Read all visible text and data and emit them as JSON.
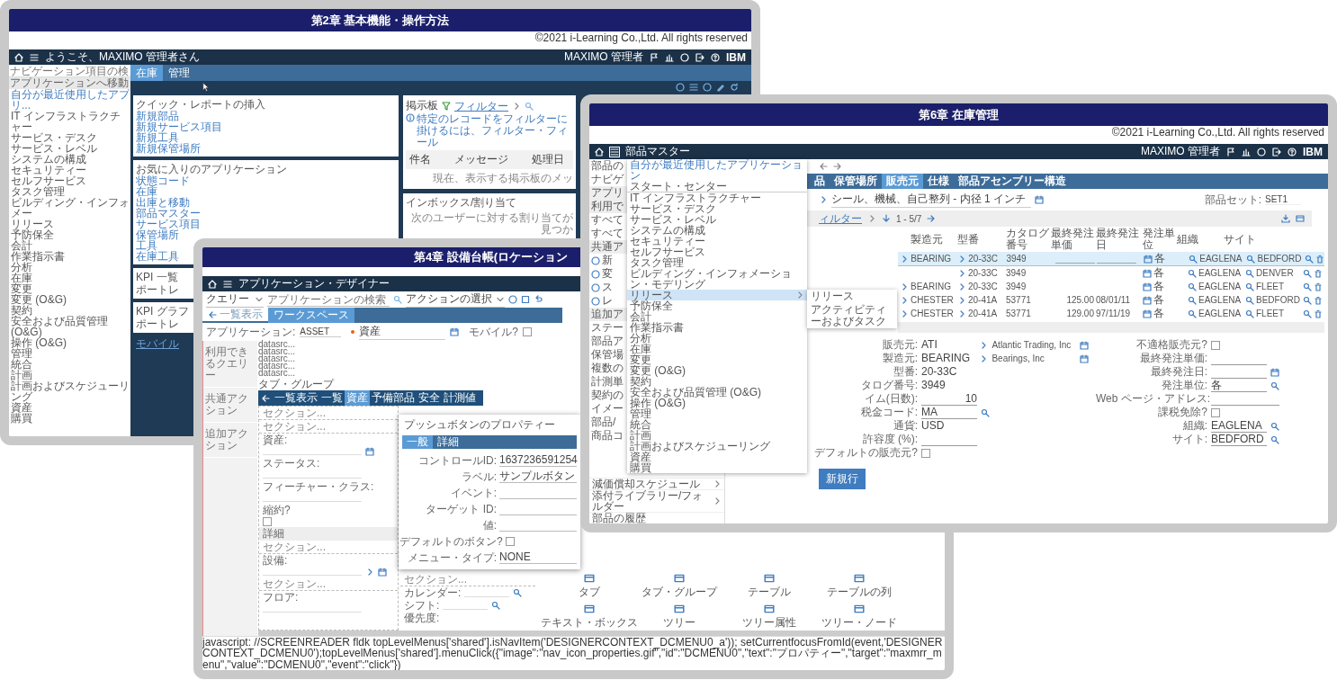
{
  "slide_basic": {
    "title": "第2章 基本機能・操作方法",
    "copyright": "©2021 i-Learning Co.,Ltd. All rights reserved",
    "navbar": {
      "title": "ようこそ、MAXIMO 管理者さん",
      "user": "MAXIMO 管理者",
      "brand": "IBM"
    },
    "sidebar": {
      "search_placeholder": "ナビゲーション項目の検",
      "header": "アプリケーションへ移動",
      "items": [
        {
          "label": "自分が最近使用したアプリ...",
          "kind": "link"
        },
        {
          "label": "IT インフラストラクチャー",
          "kind": "module"
        },
        {
          "label": "サービス・デスク",
          "kind": "module"
        },
        {
          "label": "サービス・レベル",
          "kind": "module"
        },
        {
          "label": "システムの構成",
          "kind": "module"
        },
        {
          "label": "セキュリティー",
          "kind": "module"
        },
        {
          "label": "セルフサービス",
          "kind": "module"
        },
        {
          "label": "タスク管理",
          "kind": "module"
        },
        {
          "label": "ビルディング・インフォメー",
          "kind": "module"
        },
        {
          "label": "リリース",
          "kind": "module"
        },
        {
          "label": "予防保全",
          "kind": "module"
        },
        {
          "label": "会計",
          "kind": "module"
        },
        {
          "label": "作業指示書",
          "kind": "module"
        },
        {
          "label": "分析",
          "kind": "module"
        },
        {
          "label": "在庫",
          "kind": "module"
        },
        {
          "label": "変更",
          "kind": "module"
        },
        {
          "label": "変更 (O&G)",
          "kind": "module"
        },
        {
          "label": "契約",
          "kind": "module"
        },
        {
          "label": "安全および品質管理 (O&G)",
          "kind": "module"
        },
        {
          "label": "操作 (O&G)",
          "kind": "module"
        },
        {
          "label": "管理",
          "kind": "module"
        },
        {
          "label": "統合",
          "kind": "module"
        },
        {
          "label": "計画",
          "kind": "module"
        },
        {
          "label": "計画およびスケジューリング",
          "kind": "module"
        },
        {
          "label": "資産",
          "kind": "module"
        },
        {
          "label": "購買",
          "kind": "module"
        }
      ]
    },
    "tabs": [
      {
        "label": "在庫",
        "selected": true
      },
      {
        "label": "管理",
        "selected": false
      }
    ],
    "quick_report": {
      "title": "クイック・レポートの挿入",
      "links": [
        "新規部品",
        "新規サービス項目",
        "新規工具",
        "新規保管場所"
      ]
    },
    "favorites": {
      "title": "お気に入りのアプリケーション",
      "links": [
        "状態コード",
        "在庫",
        "出庫と移動",
        "部品マスター",
        "サービス項目",
        "保管場所",
        "工具",
        "在庫工具"
      ]
    },
    "kpi_portlets": [
      {
        "title": "KPI 一覧",
        "message": "ポートレ"
      },
      {
        "title": "KPI グラフ",
        "message": "ポートレ"
      }
    ],
    "mobile_link": "モバイル",
    "bulletin": {
      "title": "掲示板",
      "filter": "フィルター",
      "info": "特定のレコードをフィルターに掛けるには、フィルター・フィール",
      "columns": [
        "件名",
        "メッセージ",
        "処理日"
      ],
      "empty": "現在、表示する掲示板のメッ"
    },
    "inbox": {
      "title": "インボックス/割り当て",
      "empty": "次のユーザーに対する割り当てが見つか"
    }
  },
  "slide_designer": {
    "title": "第4章 設備台帳(ロケーション",
    "navbar": {
      "title": "アプリケーション・デザイナー"
    },
    "toolbar": {
      "query": "クエリー",
      "search_placeholder": "アプリケーションの検索",
      "action": "アクションの選択"
    },
    "tabs": [
      {
        "label": "一覧表示",
        "selected": false
      },
      {
        "label": "ワークスペース",
        "selected": true
      }
    ],
    "app_label": "アプリケーション:",
    "app_value": "ASSET",
    "desc_value": "資産",
    "mobile_label": "モバイル?",
    "mobile_checked": false,
    "left_panel": [
      "利用できるクエリー",
      "共通アクション",
      "追加アクション"
    ],
    "datasources": [
      "datasrc...",
      "datasrc...",
      "datasrc...",
      "datasrc...",
      "datasrc..."
    ],
    "tab_group": "タブ・グループ",
    "inner_tabs": [
      {
        "label": "一覧表示",
        "selected": false
      },
      {
        "label": "一覧",
        "selected": false
      },
      {
        "label": "資産",
        "selected": true
      },
      {
        "label": "予備部品",
        "selected": false
      },
      {
        "label": "安全",
        "selected": false
      },
      {
        "label": "計測値",
        "selected": false
      }
    ],
    "canvas_left": [
      {
        "kind": "section",
        "label": "セクション..."
      },
      {
        "kind": "section",
        "label": "セクション..."
      },
      {
        "kind": "date_field",
        "label": "資産:"
      },
      {
        "kind": "field",
        "label": "ステータス:"
      },
      {
        "kind": "field",
        "label": "フィーチャー・クラス:"
      },
      {
        "kind": "checkbox",
        "label": "縮約?",
        "checked": false
      },
      {
        "kind": "band",
        "label": "詳細"
      },
      {
        "kind": "section",
        "label": "セクション..."
      },
      {
        "kind": "link_field",
        "label": "設備:"
      },
      {
        "kind": "section",
        "label": "セクション..."
      },
      {
        "kind": "field",
        "label": "フロア:"
      }
    ],
    "canvas_right": [
      {
        "kind": "section",
        "label": "セクション..."
      },
      {
        "kind": "lookup_field",
        "label": "カレンダー:"
      },
      {
        "kind": "lookup_field",
        "label": "シフト:"
      },
      {
        "kind": "field",
        "label": "優先度:"
      }
    ],
    "palette": [
      "タブ",
      "タブ・グループ",
      "テーブル",
      "テーブルの列",
      "テキスト・ボックス",
      "ツリー",
      "ツリー属性",
      "ツリー・ノード"
    ],
    "dialog": {
      "title": "プッシュボタンのプロパティー",
      "tabs": [
        {
          "label": "一般",
          "selected": true
        },
        {
          "label": "詳細",
          "selected": false
        }
      ],
      "fields": [
        {
          "label": "コントロールID:",
          "value": "1637236591254",
          "kind": "text"
        },
        {
          "label": "ラベル:",
          "value": "サンプルボタン",
          "kind": "text"
        },
        {
          "label": "イベント:",
          "kind": "text"
        },
        {
          "label": "ターゲット ID:",
          "kind": "text"
        },
        {
          "label": "値:",
          "kind": "text"
        },
        {
          "label": "デフォルトのボタン?",
          "kind": "checkbox",
          "checked": false
        },
        {
          "label": "メニュー・タイプ:",
          "value": "NONE",
          "kind": "text"
        }
      ]
    },
    "status": "javascript: //SCREENREADER fldk topLevelMenus['shared'].isNavItem('DESIGNERCONTEXT_DCMENU0_a')); setCurrentfocusFromId(event,'DESIGNERCONTEXT_DCMENU0');topLevelMenus['shared'].menuClick({\"image\":\"nav_icon_properties.gif\",\"id\":\"DCMENU0\",\"text\":\"プロパティー\",\"target\":\"maxmrr_menu\",\"value\":\"DCMENU0\",\"event\":\"click\"})"
  },
  "slide_inventory": {
    "title": "第6章 在庫管理",
    "copyright": "©2021 i-Learning Co.,Ltd. All rights reserved",
    "navbar": {
      "title": "部品マスター",
      "user": "MAXIMO 管理者",
      "brand": "IBM"
    },
    "sidebar_top": [
      {
        "label": "部品の",
        "kind": "text"
      },
      {
        "label": "ナビゲ",
        "kind": "text"
      },
      {
        "label": "アプリ",
        "kind": "header"
      },
      {
        "label": "利用で",
        "kind": "header"
      },
      {
        "label": "すべて",
        "kind": "text"
      },
      {
        "label": "すべて",
        "kind": "text"
      },
      {
        "label": "共通ア",
        "kind": "header"
      },
      {
        "label": "新",
        "kind": "action"
      },
      {
        "label": "変",
        "kind": "action"
      },
      {
        "label": "ス",
        "kind": "action"
      },
      {
        "label": "レ",
        "kind": "action"
      },
      {
        "label": "追加ア",
        "kind": "header"
      },
      {
        "label": "ステー",
        "kind": "text"
      },
      {
        "label": "部品ア",
        "kind": "text"
      },
      {
        "label": "保管場",
        "kind": "text"
      },
      {
        "label": "複数の",
        "kind": "text"
      },
      {
        "label": "計測単",
        "kind": "text"
      },
      {
        "label": "契約の",
        "kind": "text"
      },
      {
        "label": "イメー",
        "kind": "text"
      },
      {
        "label": "部品/",
        "kind": "text"
      },
      {
        "label": "商品コ",
        "kind": "text"
      }
    ],
    "sidebar_bottom": [
      {
        "label": "減価償却スケジュール",
        "has_submenu": true
      },
      {
        "label": "添付ライブラリー/フォルダー",
        "has_submenu": true
      },
      {
        "label": "部品の履歴",
        "has_submenu": false
      }
    ],
    "menu": [
      {
        "label": "自分が最近使用したアプリケーション",
        "kind": "recent",
        "selected": false,
        "has_submenu": false
      },
      {
        "label": "スタート・センター",
        "kind": "start",
        "selected": false,
        "has_submenu": false
      },
      {
        "label": "IT インフラストラクチャー",
        "kind": "module",
        "selected": false,
        "has_submenu": false
      },
      {
        "label": "サービス・デスク",
        "kind": "module",
        "selected": false,
        "has_submenu": false
      },
      {
        "label": "サービス・レベル",
        "kind": "module",
        "selected": false,
        "has_submenu": false
      },
      {
        "label": "システムの構成",
        "kind": "module",
        "selected": false,
        "has_submenu": false
      },
      {
        "label": "セキュリティー",
        "kind": "module",
        "selected": false,
        "has_submenu": false
      },
      {
        "label": "セルフサービス",
        "kind": "module",
        "selected": false,
        "has_submenu": false
      },
      {
        "label": "タスク管理",
        "kind": "module",
        "selected": false,
        "has_submenu": false
      },
      {
        "label": "ビルディング・インフォメーション・モデリング",
        "kind": "module",
        "selected": false,
        "has_submenu": false
      },
      {
        "label": "リリース",
        "kind": "module",
        "selected": true,
        "has_submenu": true
      },
      {
        "label": "予防保全",
        "kind": "module",
        "selected": false,
        "has_submenu": false
      },
      {
        "label": "会計",
        "kind": "module",
        "selected": false,
        "has_submenu": false
      },
      {
        "label": "作業指示書",
        "kind": "module",
        "selected": false,
        "has_submenu": false
      },
      {
        "label": "分析",
        "kind": "module",
        "selected": false,
        "has_submenu": false
      },
      {
        "label": "在庫",
        "kind": "module",
        "selected": false,
        "has_submenu": false
      },
      {
        "label": "変更",
        "kind": "module",
        "selected": false,
        "has_submenu": false
      },
      {
        "label": "変更 (O&G)",
        "kind": "module",
        "selected": false,
        "has_submenu": false
      },
      {
        "label": "契約",
        "kind": "module",
        "selected": false,
        "has_submenu": false
      },
      {
        "label": "安全および品質管理 (O&G)",
        "kind": "module",
        "selected": false,
        "has_submenu": false
      },
      {
        "label": "操作 (O&G)",
        "kind": "module",
        "selected": false,
        "has_submenu": false
      },
      {
        "label": "管理",
        "kind": "module",
        "selected": false,
        "has_submenu": false
      },
      {
        "label": "統合",
        "kind": "module",
        "selected": false,
        "has_submenu": false
      },
      {
        "label": "計画",
        "kind": "module",
        "selected": false,
        "has_submenu": false
      },
      {
        "label": "計画およびスケジューリング",
        "kind": "module",
        "selected": false,
        "has_submenu": false
      },
      {
        "label": "資産",
        "kind": "module",
        "selected": false,
        "has_submenu": false
      },
      {
        "label": "購買",
        "kind": "module",
        "selected": false,
        "has_submenu": false
      }
    ],
    "submenu": [
      "リリース",
      "アクティビティーおよびタスク"
    ],
    "tabs": [
      {
        "label": "品",
        "selected": false
      },
      {
        "label": "保管場所",
        "selected": false
      },
      {
        "label": "販売元",
        "selected": true
      },
      {
        "label": "仕様",
        "selected": false
      },
      {
        "label": "部品アセンブリー構造",
        "selected": false
      }
    ],
    "description": "シール、機械、自己整列 - 内径 1 インチ",
    "part_set_label": "部品セット:",
    "part_set_value": "SET1",
    "filter": "ィルター",
    "pager": "1 - 5/7",
    "table": {
      "columns": [
        "製造元",
        "型番",
        "カタログ番号",
        "最終発注単価",
        "最終発注日",
        "発注単位",
        "組織",
        "サイト"
      ],
      "rows": [
        {
          "selected": true,
          "editable": true,
          "maker": "BEARING",
          "model": "20-33C",
          "catalog": "3949",
          "unit": "各",
          "org": "EAGLENA",
          "site": "BEDFORD"
        },
        {
          "selected": false,
          "editable": false,
          "model": "20-33C",
          "catalog": "3949",
          "unit": "各",
          "org": "EAGLENA",
          "site": "DENVER"
        },
        {
          "selected": false,
          "editable": false,
          "maker": "BEARING",
          "model": "20-33C",
          "catalog": "3949",
          "unit": "各",
          "org": "EAGLENA",
          "site": "FLEET"
        },
        {
          "selected": false,
          "editable": false,
          "maker": "CHESTER",
          "model": "20-41A",
          "catalog": "53771",
          "last_price": "125.00",
          "last_date": "08/01/11",
          "unit": "各",
          "org": "EAGLENA",
          "site": "BEDFORD"
        },
        {
          "selected": false,
          "editable": false,
          "maker": "CHESTER",
          "model": "20-41A",
          "catalog": "53771",
          "last_price": "129.00",
          "last_date": "97/11/19",
          "unit": "各",
          "org": "EAGLENA",
          "site": "FLEET"
        }
      ]
    },
    "form_left": [
      {
        "label": "販売元:",
        "value": "ATI",
        "link": "Atlantic Trading, Inc",
        "kind": "lookup"
      },
      {
        "label": "製造元:",
        "value": "BEARING",
        "link": "Bearings, Inc",
        "kind": "lookup"
      },
      {
        "label": "型番:",
        "value": "20-33C",
        "kind": "text"
      },
      {
        "label": "タログ番号:",
        "value": "3949",
        "kind": "text"
      },
      {
        "label": "イム(日数):",
        "value": "10",
        "kind": "input"
      },
      {
        "label": "税金コード:",
        "value": "MA",
        "kind": "search"
      },
      {
        "label": "通貨:",
        "value": "USD",
        "kind": "text"
      },
      {
        "label": "許容度 (%):",
        "kind": "input"
      },
      {
        "label": "デフォルトの販売元?",
        "kind": "checkbox",
        "checked": false
      }
    ],
    "form_right": [
      {
        "label": "不適格販売元?",
        "kind": "checkbox",
        "checked": false
      },
      {
        "label": "最終発注単価:",
        "kind": "input"
      },
      {
        "label": "最終発注日:",
        "kind": "date"
      },
      {
        "label": "発注単位:",
        "value": "各",
        "kind": "search"
      },
      {
        "label": "Web ページ・アドレス:",
        "kind": "wide"
      },
      {
        "label": "課税免除?",
        "kind": "checkbox",
        "checked": false
      },
      {
        "label": "組織:",
        "value": "EAGLENA",
        "kind": "search"
      },
      {
        "label": "サイト:",
        "value": "BEDFORD",
        "kind": "search"
      }
    ],
    "new_row_button": "新規行"
  }
}
